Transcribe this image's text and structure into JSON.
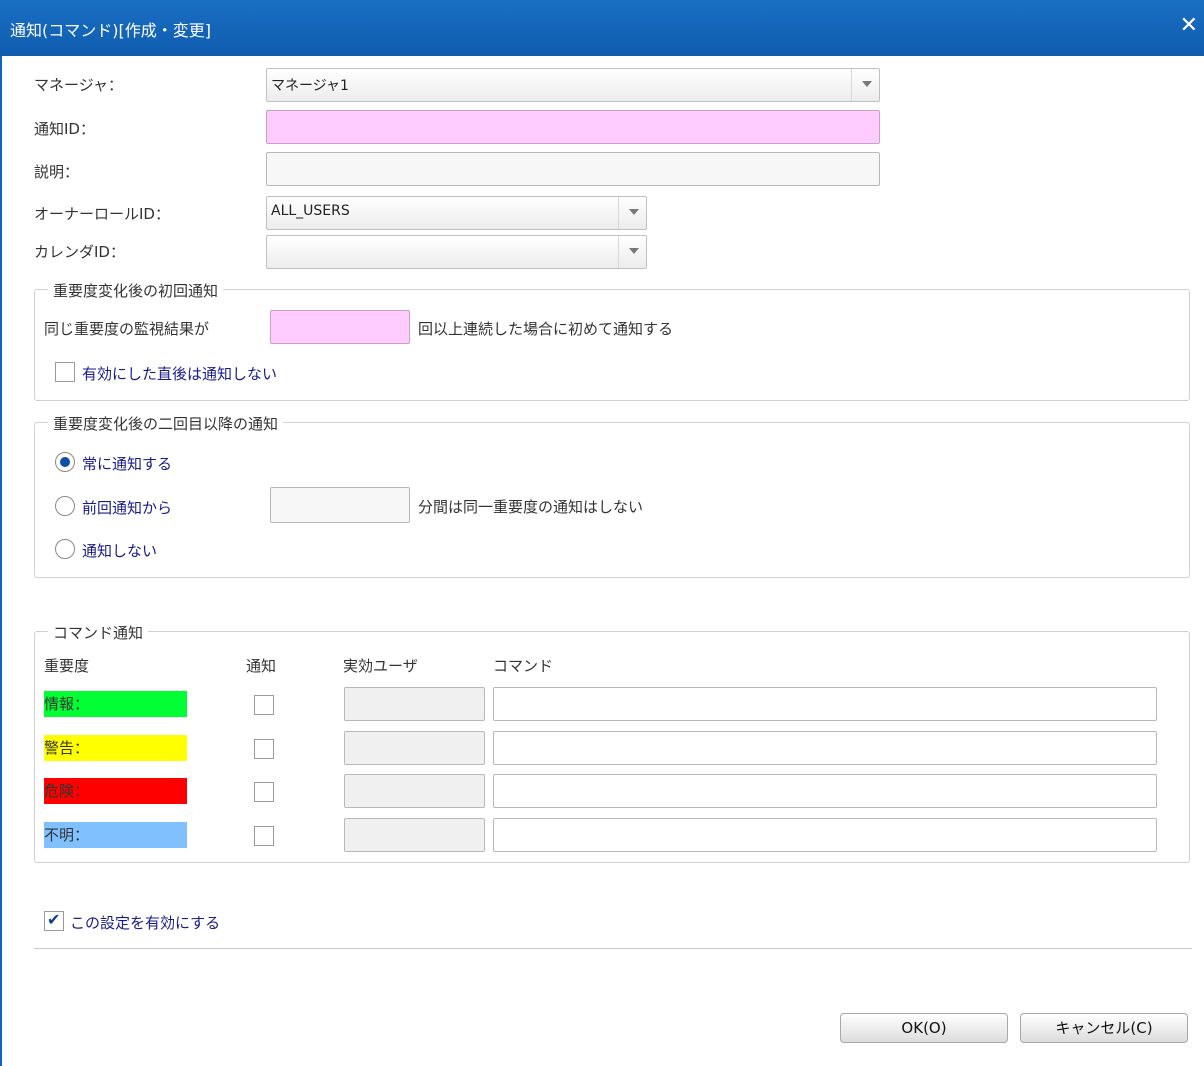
{
  "dialog": {
    "title": "通知(コマンド)[作成・変更]",
    "close_icon": "close-icon"
  },
  "form": {
    "manager_label": "マネージャ：",
    "manager_value": "マネージャ1",
    "notify_id_label": "通知ID：",
    "notify_id_value": "",
    "description_label": "説明：",
    "description_value": "",
    "owner_role_label": "オーナーロールID：",
    "owner_role_value": "ALL_USERS",
    "calendar_label": "カレンダID：",
    "calendar_value": ""
  },
  "initial_notify": {
    "legend": "重要度変化後の初回通知",
    "prefix": "同じ重要度の監視結果が",
    "count_value": "",
    "suffix": "回以上連続した場合に初めて通知する",
    "no_notify_after_enable": "有効にした直後は通知しない",
    "no_notify_after_enable_checked": false
  },
  "subsequent_notify": {
    "legend": "重要度変化後の二回目以降の通知",
    "options": [
      {
        "label": "常に通知する",
        "selected": true
      },
      {
        "label": "前回通知から",
        "selected": false
      },
      {
        "label": "通知しない",
        "selected": false
      }
    ],
    "minutes_value": "",
    "minutes_suffix": "分間は同一重要度の通知はしない"
  },
  "command_notify": {
    "legend": "コマンド通知",
    "headers": {
      "severity": "重要度",
      "notify": "通知",
      "effective_user": "実効ユーザ",
      "command": "コマンド"
    },
    "rows": [
      {
        "label": "情報：",
        "color": "#00ff33",
        "notify": false,
        "user": "",
        "command": ""
      },
      {
        "label": "警告：",
        "color": "#ffff00",
        "notify": false,
        "user": "",
        "command": ""
      },
      {
        "label": "危険：",
        "color": "#ff0000",
        "notify": false,
        "user": "",
        "command": ""
      },
      {
        "label": "不明：",
        "color": "#80c0ff",
        "notify": false,
        "user": "",
        "command": ""
      }
    ]
  },
  "enable_setting": {
    "label": "この設定を有効にする",
    "checked": true
  },
  "buttons": {
    "ok": "OK(O)",
    "cancel": "キャンセル(C)"
  }
}
